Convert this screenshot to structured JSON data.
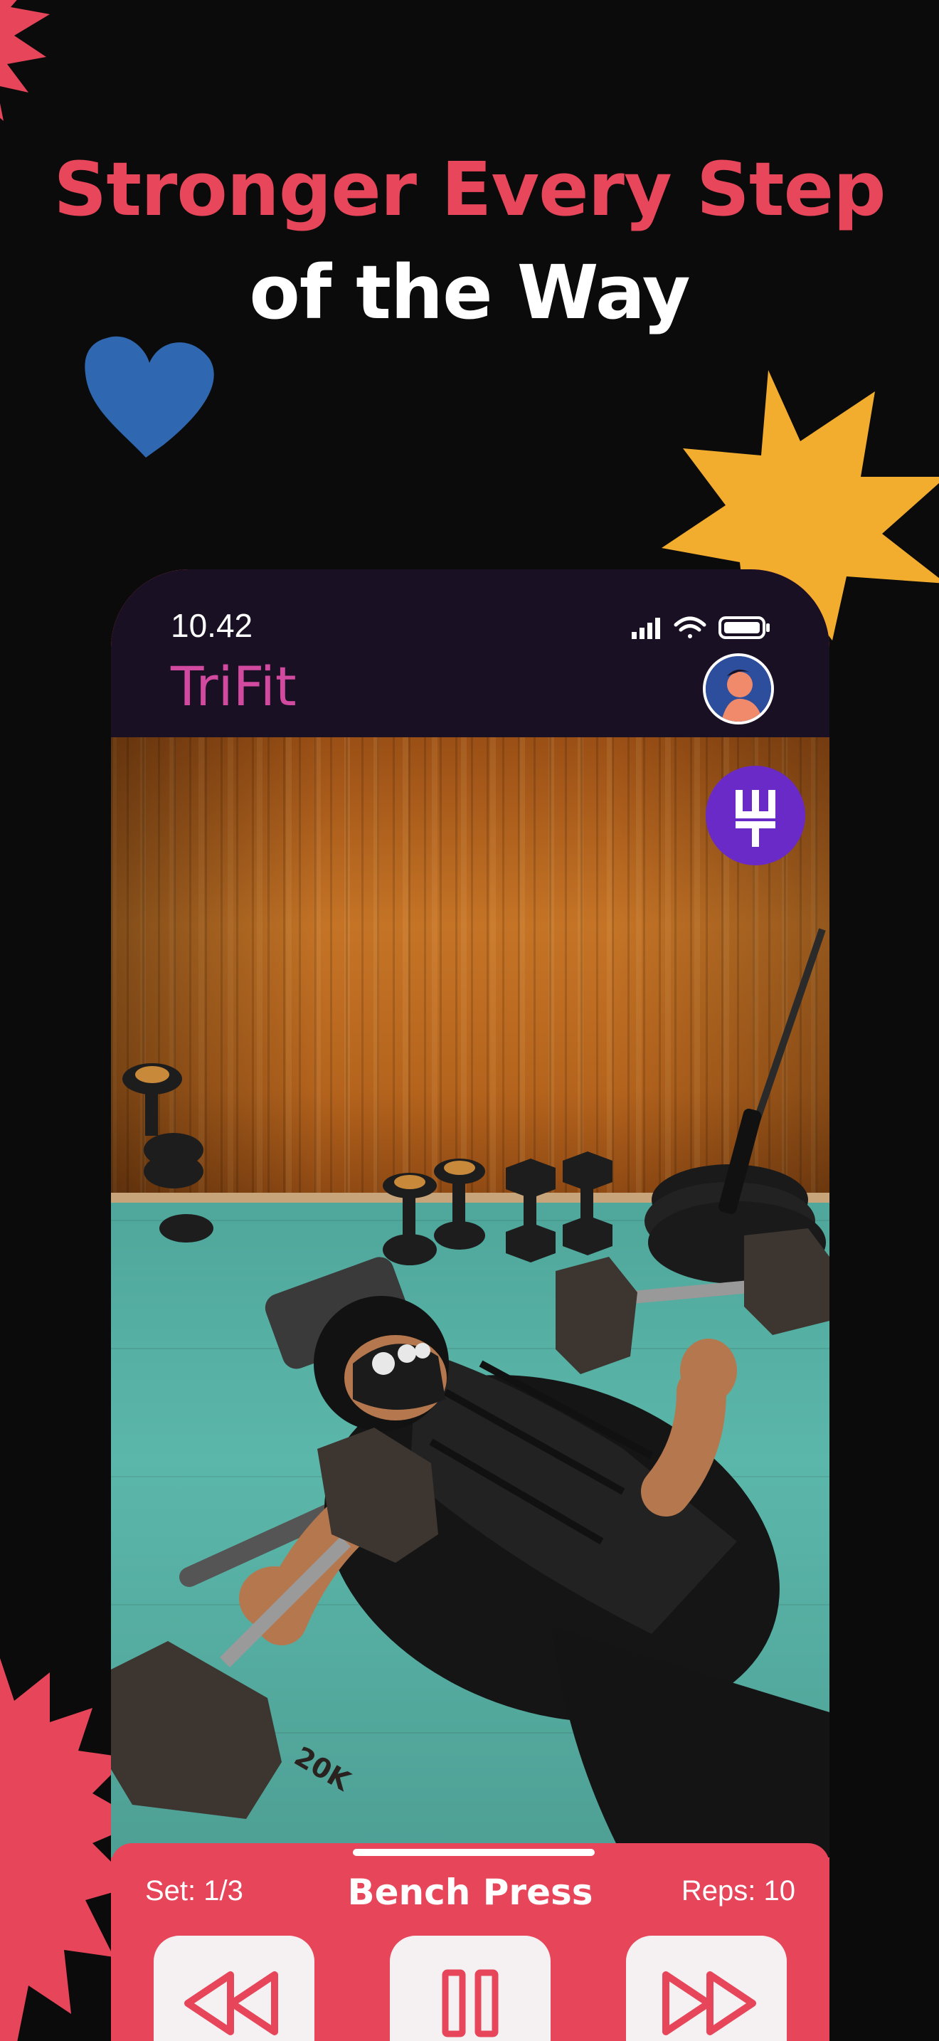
{
  "headline": {
    "line1": "Stronger Every Step",
    "line2": "of the Way"
  },
  "status_bar": {
    "time": "10.42",
    "icons": [
      "signal-icon",
      "wifi-icon",
      "battery-icon"
    ]
  },
  "app": {
    "title": "TriFit",
    "profile_avatar": "avatar",
    "brand_badge_icon": "trident-icon"
  },
  "workout": {
    "set_label": "Set: 1/3",
    "exercise_name": "Bench Press",
    "reps_label": "Reps: 10"
  },
  "controls": {
    "rewind_icon": "rewind-icon",
    "pause_icon": "pause-icon",
    "forward_icon": "fast-forward-icon"
  },
  "photo": {
    "dumbbell_label": "20K"
  },
  "colors": {
    "background": "#0b0b0b",
    "accent_red": "#e7455a",
    "header_dark": "#1a1024",
    "title_pink": "#d14aa0",
    "badge_purple": "#6a2ac7",
    "heart_blue": "#2f68b0",
    "star_yellow": "#f2ad2f"
  }
}
